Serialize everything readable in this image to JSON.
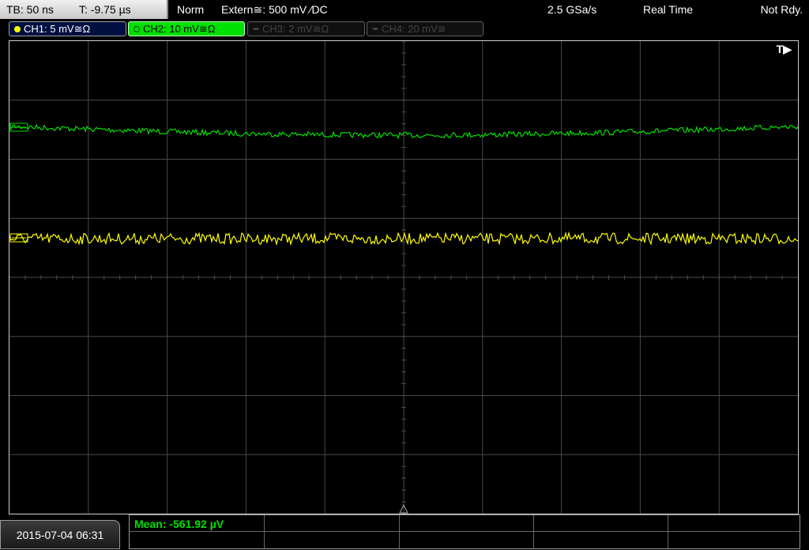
{
  "topbar": {
    "timebase": "TB: 50 ns",
    "trigger_time": "T: -9.75 µs",
    "mode": "Norm",
    "trigger_source": "Extern≅: 500 mV ⁄DC",
    "sample_rate": "2.5 GSa/s",
    "acq_mode": "Real Time",
    "status": "Not Rdy."
  },
  "channels": [
    {
      "label": "CH1: 5 mV≅Ω"
    },
    {
      "label": "CH2: 10 mV≅Ω"
    },
    {
      "label": "CH3: 2 mV≅Ω"
    },
    {
      "label": "CH4: 20 mV≅"
    }
  ],
  "graticule": {
    "trigger_marker": "T▶"
  },
  "bottom": {
    "datetime": "2015-07-04 06:31",
    "measurement": "Mean: -561.92 µV"
  },
  "colors": {
    "ch1": "#ffff00",
    "ch2": "#00e000",
    "grid": "#4a4a4a"
  }
}
